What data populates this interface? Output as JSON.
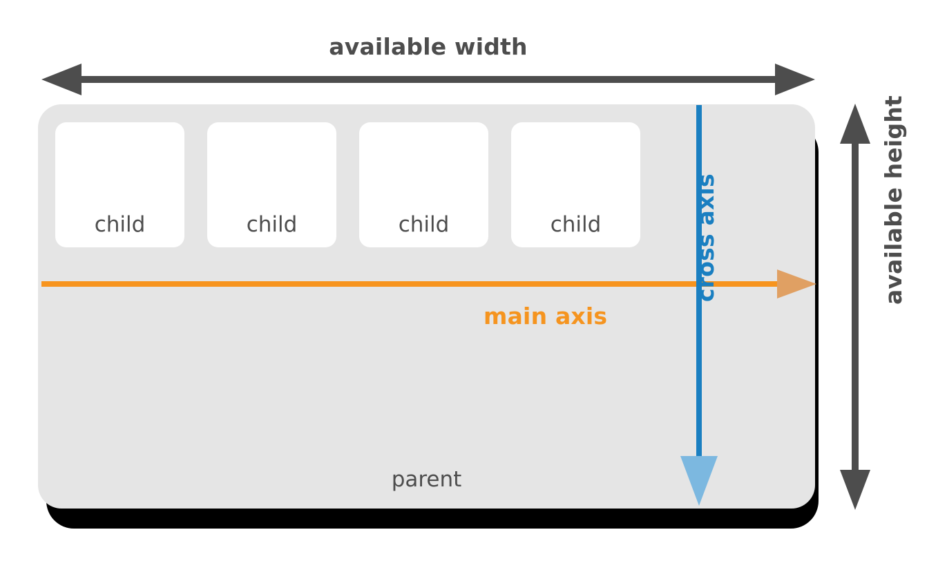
{
  "diagram": {
    "title_top": "available width",
    "title_right": "available height",
    "parent": {
      "label": "parent",
      "bg_color": "#e5e5e5",
      "shadow_color": "#000000",
      "corner_radius": "34px"
    },
    "children": [
      {
        "label": "child"
      },
      {
        "label": "child"
      },
      {
        "label": "child"
      },
      {
        "label": "child"
      }
    ],
    "axes": [
      {
        "id": "main-axis",
        "label": "main axis",
        "direction": "horizontal-right",
        "line_color": "#f7941e",
        "arrow_color": "#e0a063"
      },
      {
        "id": "cross-axis",
        "label": "cross axis",
        "direction": "vertical-down",
        "line_color": "#1a7fc1",
        "arrow_color": "#7cb8e0"
      }
    ],
    "measure_arrows": [
      {
        "id": "available-width-arrow",
        "orientation": "horizontal",
        "heads": "both",
        "color": "#4d4d4d"
      },
      {
        "id": "available-height-arrow",
        "orientation": "vertical",
        "heads": "both",
        "color": "#4d4d4d"
      }
    ],
    "colors": {
      "text": "#4d4d4d",
      "child_bg": "#ffffff",
      "parent_bg": "#e5e5e5",
      "main_axis": "#f7941e",
      "cross_axis": "#1a7fc1",
      "page_bg": "#ffffff"
    }
  }
}
